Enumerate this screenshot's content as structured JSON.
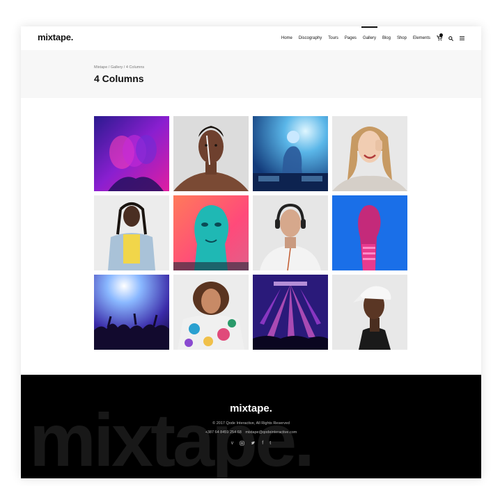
{
  "header": {
    "logo": "mixtape.",
    "nav": [
      "Home",
      "Discography",
      "Tours",
      "Pages",
      "Gallery",
      "Blog",
      "Shop",
      "Elements"
    ],
    "active_nav": "Gallery",
    "cart_icon": "cart-icon",
    "search_icon": "search-icon",
    "menu_icon": "menu-icon"
  },
  "breadcrumb": [
    "Mixtape",
    "Gallery",
    "4 Columns"
  ],
  "page_title": "4 Columns",
  "gallery": {
    "items": [
      "purple-neon-portrait",
      "woman-face-paint",
      "dj-blue-light",
      "laughing-blonde-woman",
      "woman-yellow-shirt",
      "teal-distorted-face",
      "man-headphones",
      "pink-sculpture-blue",
      "concert-crowd-blue",
      "woman-floral-hoodie",
      "stage-pink-lights",
      "man-white-cap"
    ]
  },
  "footer": {
    "logo": "mixtape.",
    "watermark": "mixtape.",
    "copyright": "© 2017 Qode Interactive, All Rights Reserved",
    "phone": "+387 64 8459 254 68",
    "email": "mixtape@qodeinteractive.com",
    "social": [
      "vimeo-icon",
      "instagram-icon",
      "twitter-icon",
      "facebook-icon",
      "tumblr-icon"
    ]
  },
  "colors": {
    "accent": "#111111",
    "title_band": "#f7f7f7",
    "footer_bg": "#000000"
  }
}
